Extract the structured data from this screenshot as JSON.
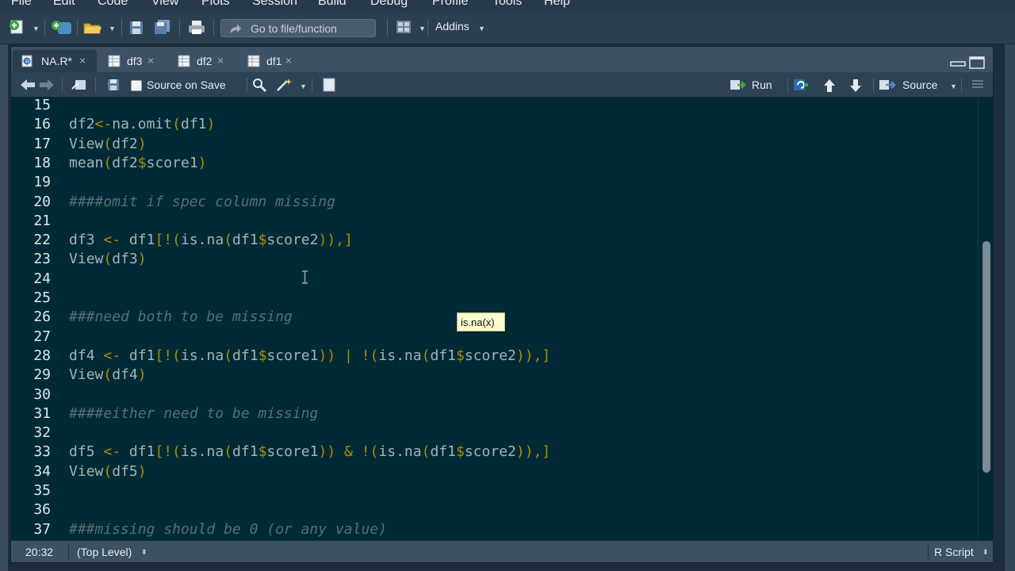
{
  "menu": [
    "File",
    "Edit",
    "Code",
    "View",
    "Plots",
    "Session",
    "Build",
    "Debug",
    "Profile",
    "Tools",
    "Help"
  ],
  "toolbar": {
    "goto_placeholder": "Go to file/function",
    "addins_label": "Addins"
  },
  "tabs": [
    {
      "label": "NA.R*",
      "active": true,
      "icon": "r-script-icon"
    },
    {
      "label": "df3",
      "active": false,
      "icon": "table-icon"
    },
    {
      "label": "df2",
      "active": false,
      "icon": "table-icon"
    },
    {
      "label": "df1",
      "active": false,
      "icon": "table-icon"
    }
  ],
  "editor_toolbar": {
    "source_on_save": "Source on Save",
    "run": "Run",
    "source": "Source"
  },
  "code_lines": [
    {
      "num": "15",
      "text": ""
    },
    {
      "num": "16",
      "text": "df2<-na.omit(df1)"
    },
    {
      "num": "17",
      "text": "View(df2)"
    },
    {
      "num": "18",
      "text": "mean(df2$score1)"
    },
    {
      "num": "19",
      "text": ""
    },
    {
      "num": "20",
      "text": "####omit if spec column missing"
    },
    {
      "num": "21",
      "text": ""
    },
    {
      "num": "22",
      "text": "df3 <- df1[!(is.na(df1$score2)),]"
    },
    {
      "num": "23",
      "text": "View(df3)"
    },
    {
      "num": "24",
      "text": ""
    },
    {
      "num": "25",
      "text": ""
    },
    {
      "num": "26",
      "text": "###need both to be missing"
    },
    {
      "num": "27",
      "text": ""
    },
    {
      "num": "28",
      "text": "df4 <- df1[!(is.na(df1$score1)) | !(is.na(df1$score2)),]"
    },
    {
      "num": "29",
      "text": "View(df4)"
    },
    {
      "num": "30",
      "text": ""
    },
    {
      "num": "31",
      "text": "####either need to be missing"
    },
    {
      "num": "32",
      "text": ""
    },
    {
      "num": "33",
      "text": "df5 <- df1[!(is.na(df1$score1)) & !(is.na(df1$score2)),]"
    },
    {
      "num": "34",
      "text": "View(df5)"
    },
    {
      "num": "35",
      "text": ""
    },
    {
      "num": "36",
      "text": ""
    },
    {
      "num": "37",
      "text": "###missing should be 0 (or any value)"
    },
    {
      "num": "38",
      "text": ""
    }
  ],
  "tooltip": "is.na(x)",
  "status": {
    "position": "20:32",
    "scope": "(Top Level)",
    "filetype": "R Script"
  },
  "colors": {
    "editor_bg": "#002b36",
    "operator": "#b58900",
    "comment": "#586e75",
    "identifier": "#a5b3b4"
  }
}
